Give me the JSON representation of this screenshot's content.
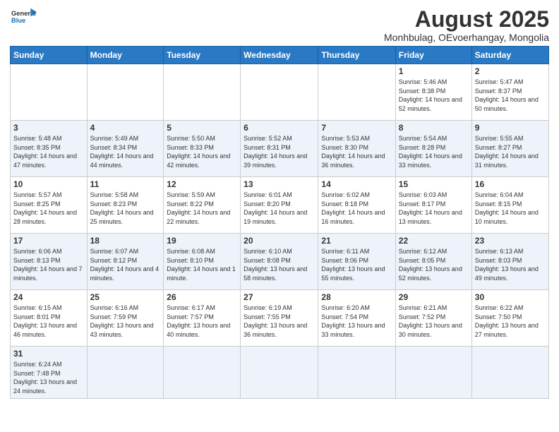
{
  "header": {
    "logo_general": "General",
    "logo_blue": "Blue",
    "title": "August 2025",
    "subtitle": "Monhbulag, OEvoerhangay, Mongolia"
  },
  "weekdays": [
    "Sunday",
    "Monday",
    "Tuesday",
    "Wednesday",
    "Thursday",
    "Friday",
    "Saturday"
  ],
  "weeks": [
    [
      {
        "day": "",
        "info": ""
      },
      {
        "day": "",
        "info": ""
      },
      {
        "day": "",
        "info": ""
      },
      {
        "day": "",
        "info": ""
      },
      {
        "day": "",
        "info": ""
      },
      {
        "day": "1",
        "info": "Sunrise: 5:46 AM\nSunset: 8:38 PM\nDaylight: 14 hours and 52 minutes."
      },
      {
        "day": "2",
        "info": "Sunrise: 5:47 AM\nSunset: 8:37 PM\nDaylight: 14 hours and 50 minutes."
      }
    ],
    [
      {
        "day": "3",
        "info": "Sunrise: 5:48 AM\nSunset: 8:35 PM\nDaylight: 14 hours and 47 minutes."
      },
      {
        "day": "4",
        "info": "Sunrise: 5:49 AM\nSunset: 8:34 PM\nDaylight: 14 hours and 44 minutes."
      },
      {
        "day": "5",
        "info": "Sunrise: 5:50 AM\nSunset: 8:33 PM\nDaylight: 14 hours and 42 minutes."
      },
      {
        "day": "6",
        "info": "Sunrise: 5:52 AM\nSunset: 8:31 PM\nDaylight: 14 hours and 39 minutes."
      },
      {
        "day": "7",
        "info": "Sunrise: 5:53 AM\nSunset: 8:30 PM\nDaylight: 14 hours and 36 minutes."
      },
      {
        "day": "8",
        "info": "Sunrise: 5:54 AM\nSunset: 8:28 PM\nDaylight: 14 hours and 33 minutes."
      },
      {
        "day": "9",
        "info": "Sunrise: 5:55 AM\nSunset: 8:27 PM\nDaylight: 14 hours and 31 minutes."
      }
    ],
    [
      {
        "day": "10",
        "info": "Sunrise: 5:57 AM\nSunset: 8:25 PM\nDaylight: 14 hours and 28 minutes."
      },
      {
        "day": "11",
        "info": "Sunrise: 5:58 AM\nSunset: 8:23 PM\nDaylight: 14 hours and 25 minutes."
      },
      {
        "day": "12",
        "info": "Sunrise: 5:59 AM\nSunset: 8:22 PM\nDaylight: 14 hours and 22 minutes."
      },
      {
        "day": "13",
        "info": "Sunrise: 6:01 AM\nSunset: 8:20 PM\nDaylight: 14 hours and 19 minutes."
      },
      {
        "day": "14",
        "info": "Sunrise: 6:02 AM\nSunset: 8:18 PM\nDaylight: 14 hours and 16 minutes."
      },
      {
        "day": "15",
        "info": "Sunrise: 6:03 AM\nSunset: 8:17 PM\nDaylight: 14 hours and 13 minutes."
      },
      {
        "day": "16",
        "info": "Sunrise: 6:04 AM\nSunset: 8:15 PM\nDaylight: 14 hours and 10 minutes."
      }
    ],
    [
      {
        "day": "17",
        "info": "Sunrise: 6:06 AM\nSunset: 8:13 PM\nDaylight: 14 hours and 7 minutes."
      },
      {
        "day": "18",
        "info": "Sunrise: 6:07 AM\nSunset: 8:12 PM\nDaylight: 14 hours and 4 minutes."
      },
      {
        "day": "19",
        "info": "Sunrise: 6:08 AM\nSunset: 8:10 PM\nDaylight: 14 hours and 1 minute."
      },
      {
        "day": "20",
        "info": "Sunrise: 6:10 AM\nSunset: 8:08 PM\nDaylight: 13 hours and 58 minutes."
      },
      {
        "day": "21",
        "info": "Sunrise: 6:11 AM\nSunset: 8:06 PM\nDaylight: 13 hours and 55 minutes."
      },
      {
        "day": "22",
        "info": "Sunrise: 6:12 AM\nSunset: 8:05 PM\nDaylight: 13 hours and 52 minutes."
      },
      {
        "day": "23",
        "info": "Sunrise: 6:13 AM\nSunset: 8:03 PM\nDaylight: 13 hours and 49 minutes."
      }
    ],
    [
      {
        "day": "24",
        "info": "Sunrise: 6:15 AM\nSunset: 8:01 PM\nDaylight: 13 hours and 46 minutes."
      },
      {
        "day": "25",
        "info": "Sunrise: 6:16 AM\nSunset: 7:59 PM\nDaylight: 13 hours and 43 minutes."
      },
      {
        "day": "26",
        "info": "Sunrise: 6:17 AM\nSunset: 7:57 PM\nDaylight: 13 hours and 40 minutes."
      },
      {
        "day": "27",
        "info": "Sunrise: 6:19 AM\nSunset: 7:55 PM\nDaylight: 13 hours and 36 minutes."
      },
      {
        "day": "28",
        "info": "Sunrise: 6:20 AM\nSunset: 7:54 PM\nDaylight: 13 hours and 33 minutes."
      },
      {
        "day": "29",
        "info": "Sunrise: 6:21 AM\nSunset: 7:52 PM\nDaylight: 13 hours and 30 minutes."
      },
      {
        "day": "30",
        "info": "Sunrise: 6:22 AM\nSunset: 7:50 PM\nDaylight: 13 hours and 27 minutes."
      }
    ],
    [
      {
        "day": "31",
        "info": "Sunrise: 6:24 AM\nSunset: 7:48 PM\nDaylight: 13 hours and 24 minutes."
      },
      {
        "day": "",
        "info": ""
      },
      {
        "day": "",
        "info": ""
      },
      {
        "day": "",
        "info": ""
      },
      {
        "day": "",
        "info": ""
      },
      {
        "day": "",
        "info": ""
      },
      {
        "day": "",
        "info": ""
      }
    ]
  ]
}
